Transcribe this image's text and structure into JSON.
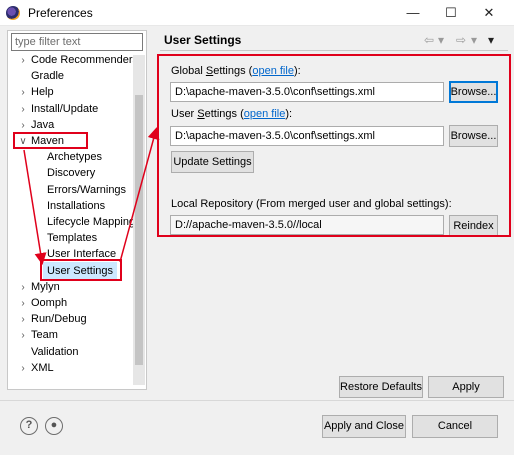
{
  "window": {
    "title": "Preferences",
    "icon": "eclipse-icon",
    "controls": [
      "minimize",
      "maximize",
      "close"
    ]
  },
  "filter": {
    "placeholder": "type filter text"
  },
  "tree": {
    "items": [
      {
        "label": "Code Recommenders",
        "expander": "›"
      },
      {
        "label": "Gradle",
        "expander": ""
      },
      {
        "label": "Help",
        "expander": "›"
      },
      {
        "label": "Install/Update",
        "expander": "›"
      },
      {
        "label": "Java",
        "expander": "›"
      },
      {
        "label": "Maven",
        "expander": "∨"
      },
      {
        "label": "Archetypes",
        "expander": ""
      },
      {
        "label": "Discovery",
        "expander": ""
      },
      {
        "label": "Errors/Warnings",
        "expander": ""
      },
      {
        "label": "Installations",
        "expander": ""
      },
      {
        "label": "Lifecycle Mapping",
        "expander": ""
      },
      {
        "label": "Templates",
        "expander": ""
      },
      {
        "label": "User Interface",
        "expander": ""
      },
      {
        "label": "User Settings",
        "expander": ""
      },
      {
        "label": "Mylyn",
        "expander": "›"
      },
      {
        "label": "Oomph",
        "expander": "›"
      },
      {
        "label": "Run/Debug",
        "expander": "›"
      },
      {
        "label": "Team",
        "expander": "›"
      },
      {
        "label": "Validation",
        "expander": ""
      },
      {
        "label": "XML",
        "expander": "›"
      }
    ],
    "selected": "User Settings"
  },
  "page": {
    "title": "User Settings",
    "nav": {
      "back": "⇦",
      "forward": "⇨",
      "menu": "▾"
    },
    "global": {
      "label_pre": "Global ",
      "label_u": "S",
      "label_post": "ettings (",
      "link": "open file",
      "label_end": "):",
      "value": "D:\\apache-maven-3.5.0\\conf\\settings.xml",
      "browse": "Browse..."
    },
    "user": {
      "label_pre": "User ",
      "label_u": "S",
      "label_post": "ettings (",
      "link": "open file",
      "label_end": "):",
      "value": "D:\\apache-maven-3.5.0\\conf\\settings.xml",
      "browse": "Browse..."
    },
    "update_button": "Update Settings",
    "local": {
      "label": "Local Repository (From merged user and global settings):",
      "value": "D://apache-maven-3.5.0//local",
      "reindex": "Reindex"
    },
    "restore_defaults": "Restore Defaults",
    "apply": "Apply"
  },
  "footer": {
    "help_icon": "help-icon",
    "import_icon": "record-icon",
    "apply_close": "Apply and Close",
    "cancel": "Cancel"
  },
  "annotation_color": "#e0001b"
}
